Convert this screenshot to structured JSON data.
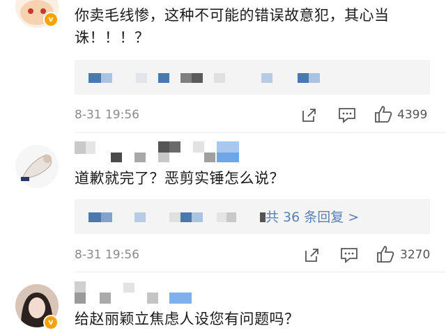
{
  "comments": [
    {
      "text": "你卖毛线惨，这种不可能的错误故意犯，其心当诛！！！？",
      "time": "8-31 19:56",
      "likes": "4399",
      "verified_badge": "v"
    },
    {
      "text": "道歉就完了？恶剪实锤怎么说？",
      "time": "8-31 19:56",
      "likes": "3270",
      "reply_link": "共 36 条回复 >"
    },
    {
      "text": "给赵丽颖立焦虑人设您有问题吗？",
      "verified_badge": "v"
    }
  ],
  "icons": {
    "share": "share-icon",
    "comment": "comment-icon",
    "like": "thumbs-up-icon"
  },
  "colors": {
    "link": "#5b7eb5",
    "meta": "#8a8a8a",
    "reply_bg": "#f4f4f4",
    "badge": "#f4a300"
  }
}
